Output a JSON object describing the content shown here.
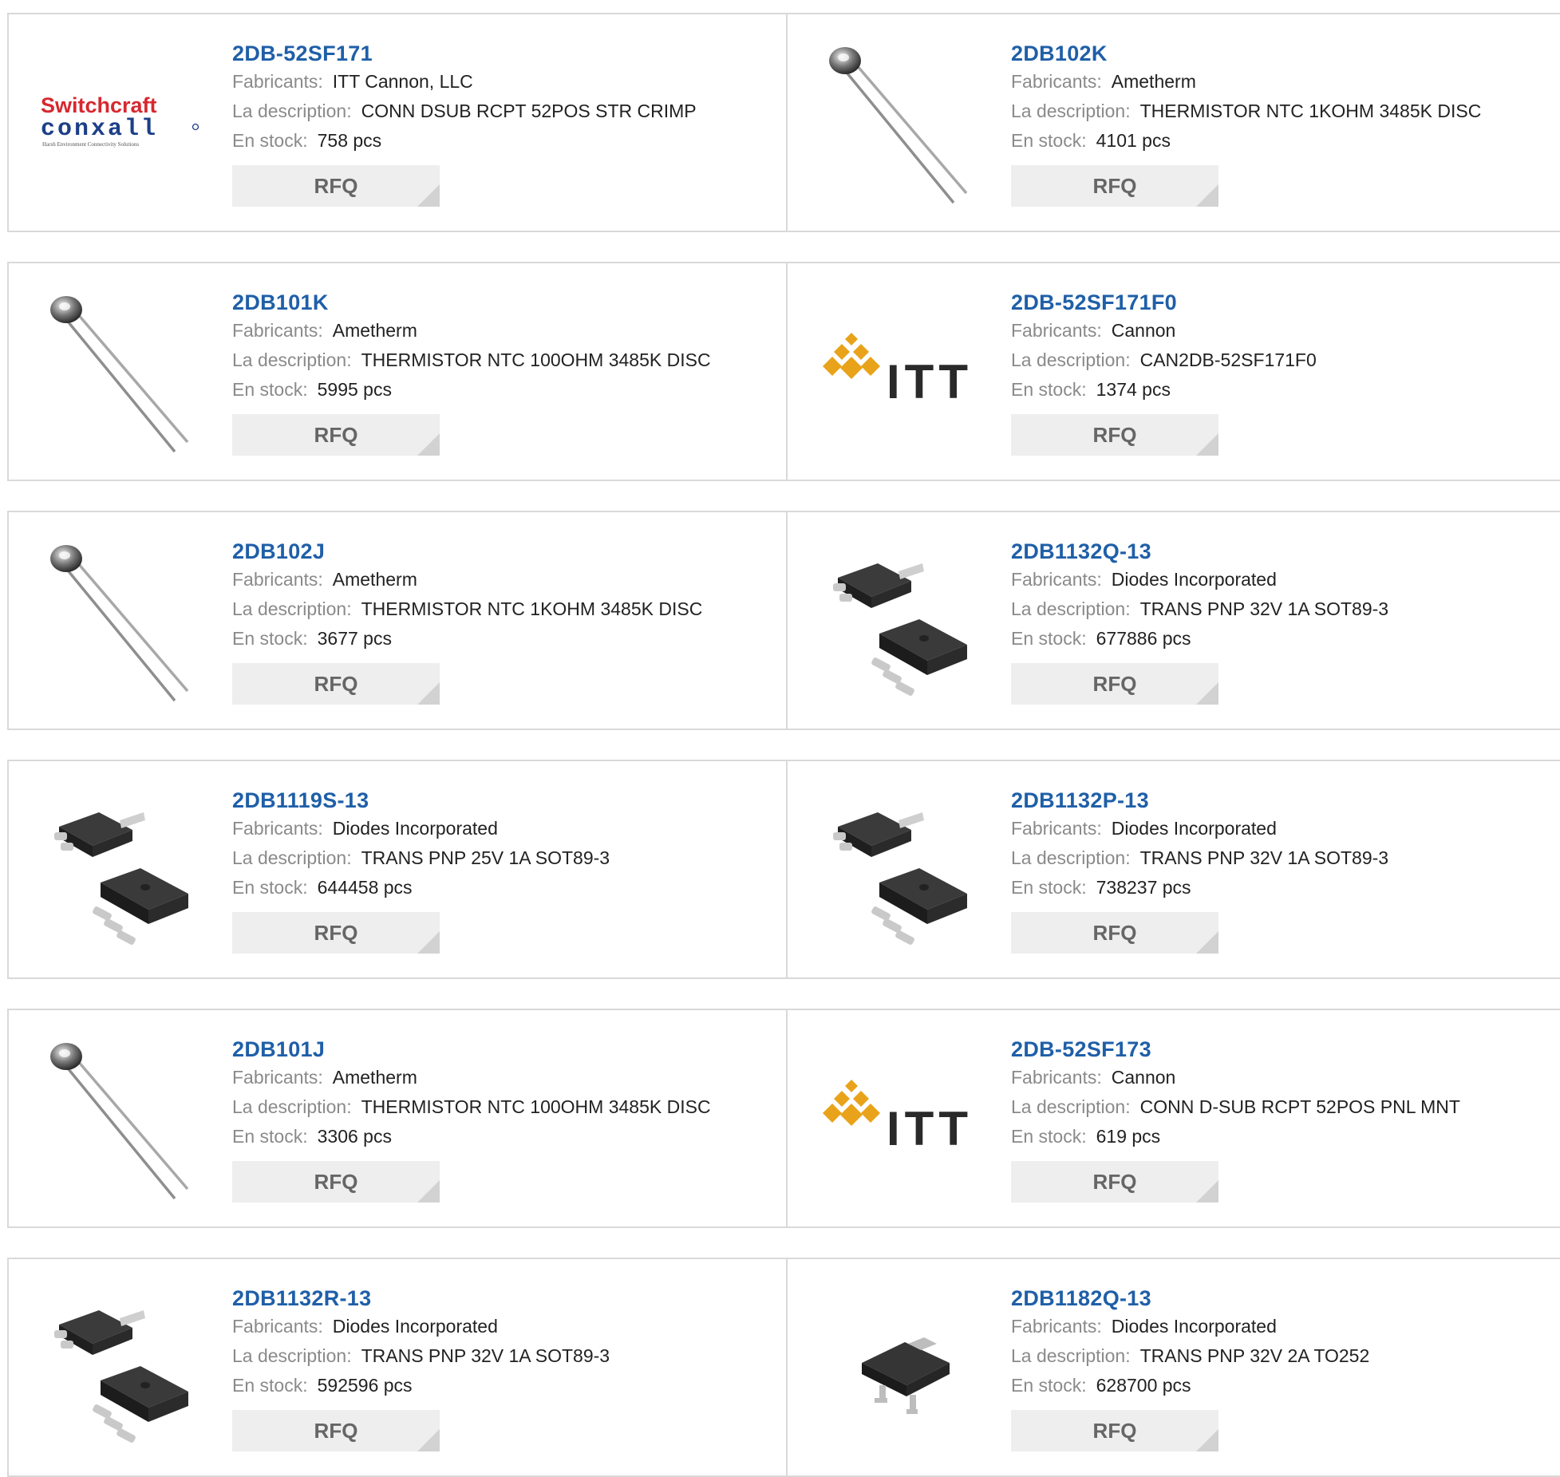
{
  "labels": {
    "manufacturer": "Fabricants:",
    "description": "La description:",
    "stock": "En stock:",
    "rfq": "RFQ"
  },
  "logos": {
    "switchcraft_line1": "Switchcraft",
    "switchcraft_line2": "conxall",
    "switchcraft_tagline": "Harsh Environment Connectivity Solutions",
    "itt": "ITT"
  },
  "colors": {
    "link": "#1f5fa8",
    "border": "#d9d9d9",
    "rfq_bg": "#eeeeee",
    "label_gray": "#8a8a8a"
  },
  "products": [
    {
      "part": "2DB-52SF171",
      "manufacturer": "ITT Cannon, LLC",
      "description": "CONN DSUB RCPT 52POS STR CRIMP",
      "stock": "758 pcs",
      "image": "switchcraft-logo"
    },
    {
      "part": "2DB102K",
      "manufacturer": "Ametherm",
      "description": "THERMISTOR NTC 1KOHM 3485K DISC",
      "stock": "4101 pcs",
      "image": "thermistor"
    },
    {
      "part": "2DB101K",
      "manufacturer": "Ametherm",
      "description": "THERMISTOR NTC 100OHM 3485K DISC",
      "stock": "5995 pcs",
      "image": "thermistor"
    },
    {
      "part": "2DB-52SF171F0",
      "manufacturer": "Cannon",
      "description": "CAN2DB-52SF171F0",
      "stock": "1374 pcs",
      "image": "itt-logo"
    },
    {
      "part": "2DB102J",
      "manufacturer": "Ametherm",
      "description": "THERMISTOR NTC 1KOHM 3485K DISC",
      "stock": "3677 pcs",
      "image": "thermistor"
    },
    {
      "part": "2DB1132Q-13",
      "manufacturer": "Diodes Incorporated",
      "description": "TRANS PNP 32V 1A SOT89-3",
      "stock": "677886 pcs",
      "image": "sot89"
    },
    {
      "part": "2DB1119S-13",
      "manufacturer": "Diodes Incorporated",
      "description": "TRANS PNP 25V 1A SOT89-3",
      "stock": "644458 pcs",
      "image": "sot89"
    },
    {
      "part": "2DB1132P-13",
      "manufacturer": "Diodes Incorporated",
      "description": "TRANS PNP 32V 1A SOT89-3",
      "stock": "738237 pcs",
      "image": "sot89"
    },
    {
      "part": "2DB101J",
      "manufacturer": "Ametherm",
      "description": "THERMISTOR NTC 100OHM 3485K DISC",
      "stock": "3306 pcs",
      "image": "thermistor"
    },
    {
      "part": "2DB-52SF173",
      "manufacturer": "Cannon",
      "description": "CONN D-SUB RCPT 52POS PNL MNT",
      "stock": "619 pcs",
      "image": "itt-logo"
    },
    {
      "part": "2DB1132R-13",
      "manufacturer": "Diodes Incorporated",
      "description": "TRANS PNP 32V 1A SOT89-3",
      "stock": "592596 pcs",
      "image": "sot89"
    },
    {
      "part": "2DB1182Q-13",
      "manufacturer": "Diodes Incorporated",
      "description": "TRANS PNP 32V 2A TO252",
      "stock": "628700 pcs",
      "image": "to252"
    }
  ]
}
